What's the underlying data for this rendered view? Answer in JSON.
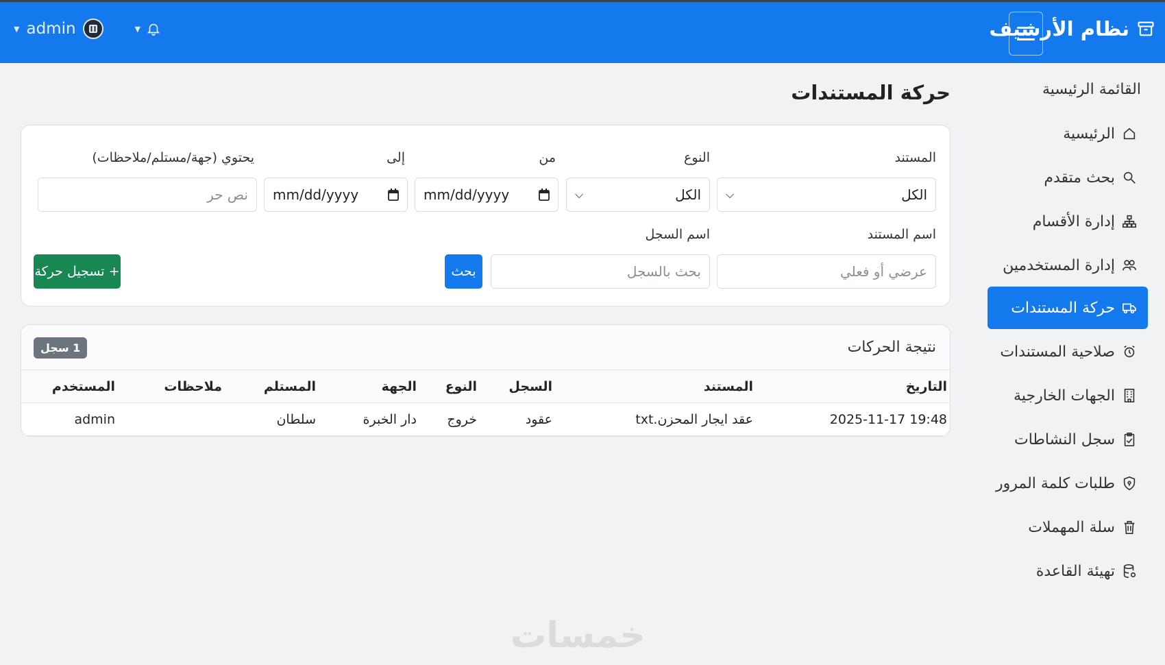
{
  "app": {
    "title": "نظام الأرشيف",
    "user": "admin"
  },
  "colors": {
    "primary": "#1479ec",
    "success": "#198754",
    "badge": "#6c757d"
  },
  "sidebar": {
    "title": "القائمة الرئيسية",
    "items": [
      {
        "label": "الرئيسية",
        "icon": "home-icon"
      },
      {
        "label": "بحث متقدم",
        "icon": "search-icon"
      },
      {
        "label": "إدارة الأقسام",
        "icon": "sitemap-icon"
      },
      {
        "label": "إدارة المستخدمين",
        "icon": "users-icon"
      },
      {
        "label": "حركة المستندات",
        "icon": "truck-icon",
        "active": true
      },
      {
        "label": "صلاحية المستندات",
        "icon": "alarm-icon"
      },
      {
        "label": "الجهات الخارجية",
        "icon": "building-icon"
      },
      {
        "label": "سجل النشاطات",
        "icon": "clipboard-icon"
      },
      {
        "label": "طلبات كلمة المرور",
        "icon": "shield-icon"
      },
      {
        "label": "سلة المهملات",
        "icon": "trash-icon"
      },
      {
        "label": "تهيئة القاعدة",
        "icon": "database-icon"
      }
    ]
  },
  "page": {
    "title": "حركة المستندات"
  },
  "filters": {
    "document_label": "المستند",
    "document_value": "الكل",
    "type_label": "النوع",
    "type_value": "الكل",
    "from_label": "من",
    "from_placeholder": "mm/dd/yyyy",
    "to_label": "إلى",
    "to_placeholder": "mm/dd/yyyy",
    "contains_label": "يحتوي (جهة/مستلم/ملاحظات)",
    "contains_placeholder": "نص حر",
    "doc_name_label": "اسم المستند",
    "doc_name_placeholder": "عرضي أو فعلي",
    "record_name_label": "اسم السجل",
    "record_name_placeholder": "بحث بالسجل",
    "search_button": "بحث",
    "record_button": "+ تسجيل حركة"
  },
  "results": {
    "title": "نتيجة الحركات",
    "count_badge": "1 سجل",
    "columns": {
      "date": "التاريخ",
      "document": "المستند",
      "record": "السجل",
      "type": "النوع",
      "party": "الجهة",
      "recipient": "المستلم",
      "notes": "ملاحظات",
      "user": "المستخدم"
    },
    "rows": [
      {
        "date": "2025-11-17 19:48",
        "document": "عقد ايجار المحزن.txt",
        "record": "عقود",
        "type": "خروج",
        "party": "دار الخبرة",
        "recipient": "سلطان",
        "notes": "",
        "user": "admin"
      }
    ]
  },
  "watermark": "خمسات"
}
